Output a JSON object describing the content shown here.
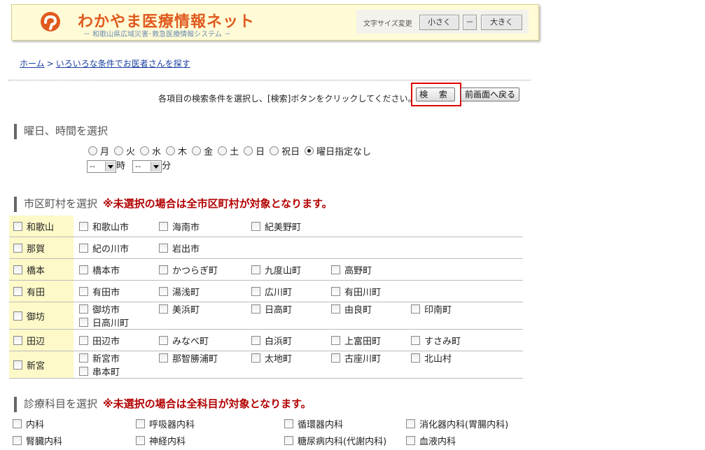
{
  "header": {
    "site_title": "わかやま医療情報ネット",
    "site_subtitle": "－ 和歌山県広域災害･救急医療情報システム －",
    "font_size_label": "文字サイズ変更",
    "font_small": "小さく",
    "font_mid": "－",
    "font_large": "大きく",
    "accent_color": "#e05a1f"
  },
  "breadcrumb": {
    "home": "ホーム",
    "separator": ">",
    "current": "いろいろな条件でお医者さんを探す"
  },
  "instruction": "各項目の検索条件を選択し、[検索]ボタンをクリックしてください。→",
  "buttons": {
    "search": "検 索",
    "back": "前画面へ戻る"
  },
  "day_section": {
    "title": "曜日、時間を選択",
    "days": [
      "月",
      "火",
      "水",
      "木",
      "金",
      "土",
      "日",
      "祝日",
      "曜日指定なし"
    ],
    "selected_day": "曜日指定なし",
    "hour_value": "--",
    "hour_unit": "時",
    "minute_value": "--",
    "minute_unit": "分"
  },
  "city_section": {
    "title": "市区町村を選択",
    "note": "※未選択の場合は全市区町村が対象となります。",
    "regions": [
      {
        "name": "和歌山",
        "towns": [
          "和歌山市",
          "海南市",
          "紀美野町"
        ]
      },
      {
        "name": "那賀",
        "towns": [
          "紀の川市",
          "岩出市"
        ]
      },
      {
        "name": "橋本",
        "towns": [
          "橋本市",
          "かつらぎ町",
          "九度山町",
          "高野町"
        ]
      },
      {
        "name": "有田",
        "towns": [
          "有田市",
          "湯浅町",
          "広川町",
          "有田川町"
        ]
      },
      {
        "name": "御坊",
        "towns": [
          "御坊市",
          "美浜町",
          "日高町",
          "由良町",
          "印南町",
          "日高川町"
        ]
      },
      {
        "name": "田辺",
        "towns": [
          "田辺市",
          "みなべ町",
          "白浜町",
          "上富田町",
          "すさみ町"
        ]
      },
      {
        "name": "新宮",
        "towns": [
          "新宮市",
          "那智勝浦町",
          "太地町",
          "古座川町",
          "北山村",
          "串本町"
        ]
      }
    ]
  },
  "dept_section": {
    "title": "診療科目を選択",
    "note": "※未選択の場合は全科目が対象となります。",
    "items": [
      "内科",
      "呼吸器内科",
      "循環器内科",
      "消化器内科(胃腸内科)",
      "腎臓内科",
      "神経内科",
      "糖尿病内科(代謝内科)",
      "血液内科"
    ]
  }
}
